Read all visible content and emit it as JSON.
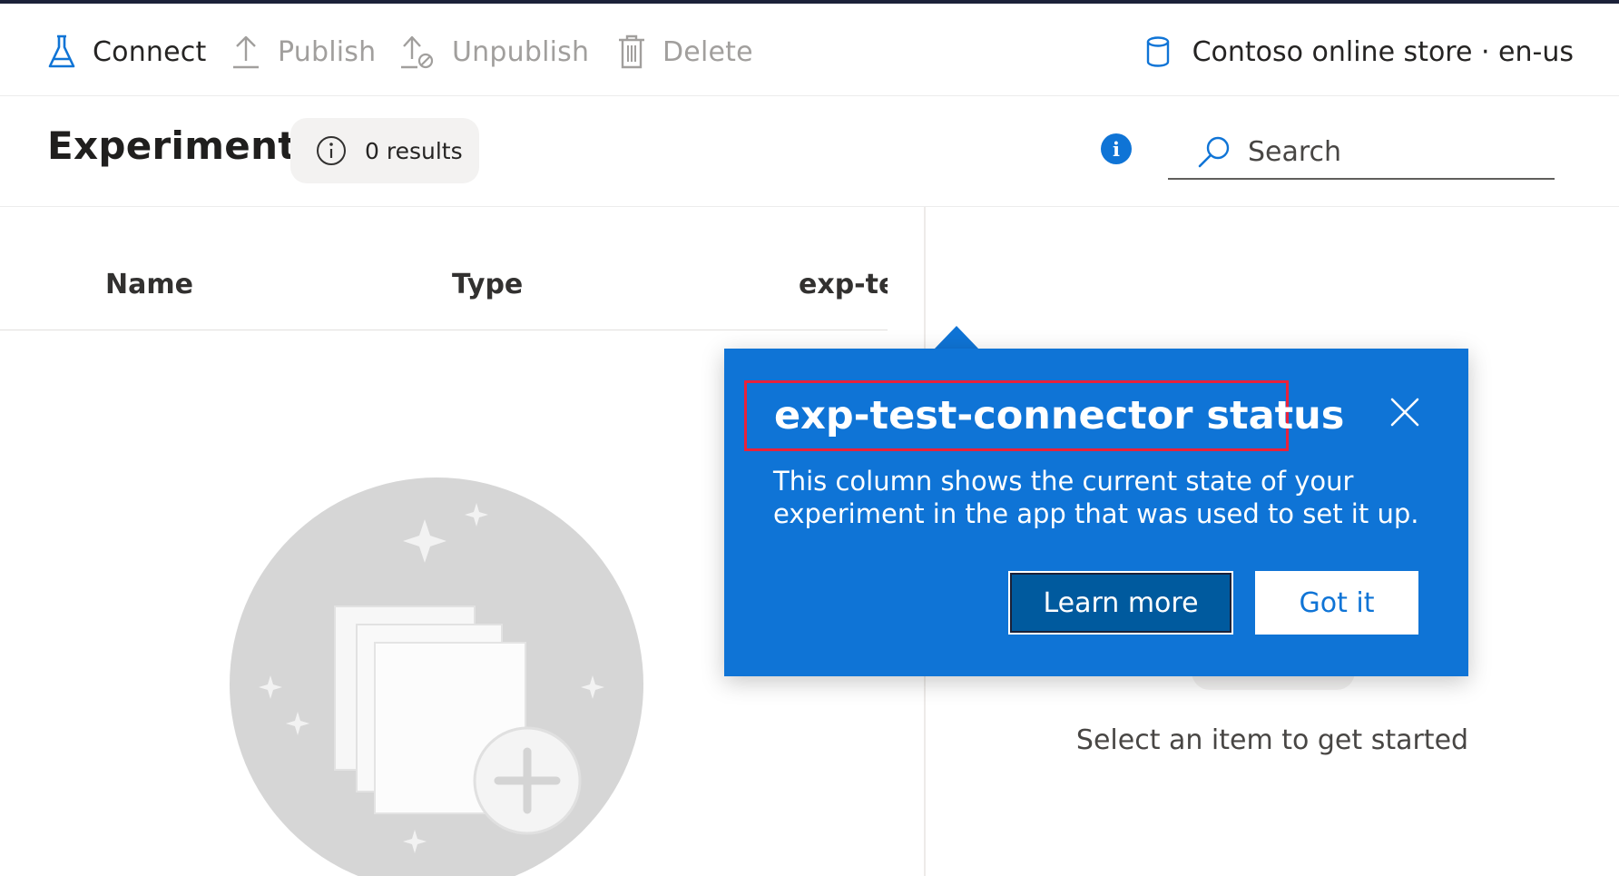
{
  "commands": {
    "connect": "Connect",
    "publish": "Publish",
    "unpublish": "Unpublish",
    "delete": "Delete"
  },
  "store": {
    "label": "Contoso online store · en-us",
    "icon": "database-icon"
  },
  "header": {
    "title": "Experiments",
    "results": "0 results",
    "info_icon_text": "i"
  },
  "search": {
    "placeholder": "Search"
  },
  "table": {
    "columns": [
      "Name",
      "Type",
      "exp-test-connector status"
    ]
  },
  "detail": {
    "empty_text": "Select an item to get started"
  },
  "teaching_bubble": {
    "title": "exp-test-connector status",
    "body": "This column shows the current state of your experiment in the app that was used to set it up.",
    "learn_more": "Learn more",
    "got_it": "Got it"
  },
  "colors": {
    "accent": "#0f74d6",
    "highlight_border": "#e8223b",
    "primary_button": "#005a9e"
  }
}
